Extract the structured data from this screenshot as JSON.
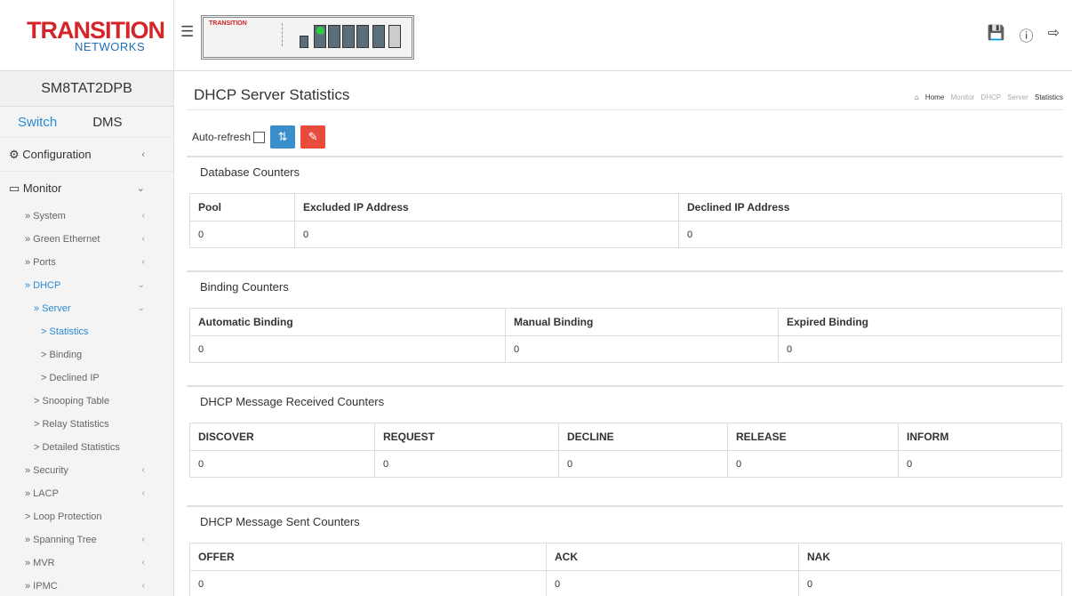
{
  "brand": {
    "logo_main": "TRANSITION",
    "logo_sub": "NETWORKS",
    "device_brand": "TRANSITION"
  },
  "header": {
    "menu_icon": "hamburger-icon",
    "icons": [
      "save-icon",
      "help-icon",
      "logout-icon"
    ]
  },
  "sidebar": {
    "device_name": "SM8TAT2DPB",
    "tabs": [
      "Switch",
      "DMS"
    ],
    "configuration": "Configuration",
    "monitor": "Monitor",
    "items": [
      {
        "label": "» System"
      },
      {
        "label": "» Green Ethernet"
      },
      {
        "label": "» Ports"
      },
      {
        "label": "» DHCP"
      },
      {
        "label": "» Server"
      },
      {
        "label": "> Statistics"
      },
      {
        "label": "> Binding"
      },
      {
        "label": "> Declined IP"
      },
      {
        "label": "> Snooping Table"
      },
      {
        "label": "> Relay Statistics"
      },
      {
        "label": "> Detailed Statistics"
      },
      {
        "label": "» Security"
      },
      {
        "label": "» LACP"
      },
      {
        "label": "> Loop Protection"
      },
      {
        "label": "» Spanning Tree"
      },
      {
        "label": "» MVR"
      },
      {
        "label": "» IPMC"
      }
    ]
  },
  "page": {
    "title": "DHCP Server Statistics",
    "breadcrumb": [
      "Home",
      "Monitor",
      "DHCP",
      "Server",
      "Statistics"
    ],
    "auto_refresh_label": "Auto-refresh",
    "auto_refresh_checked": false
  },
  "sections": {
    "database": {
      "title": "Database Counters",
      "headers": [
        "Pool",
        "Excluded IP Address",
        "Declined IP Address"
      ],
      "values": [
        "0",
        "0",
        "0"
      ]
    },
    "binding": {
      "title": "Binding Counters",
      "headers": [
        "Automatic Binding",
        "Manual Binding",
        "Expired Binding"
      ],
      "values": [
        "0",
        "0",
        "0"
      ]
    },
    "received": {
      "title": "DHCP Message Received Counters",
      "headers": [
        "DISCOVER",
        "REQUEST",
        "DECLINE",
        "RELEASE",
        "INFORM"
      ],
      "values": [
        "0",
        "0",
        "0",
        "0",
        "0"
      ]
    },
    "sent": {
      "title": "DHCP Message Sent Counters",
      "headers": [
        "OFFER",
        "ACK",
        "NAK"
      ],
      "values": [
        "0",
        "0",
        "0"
      ]
    }
  },
  "colors": {
    "accent": "#2a8ad3",
    "brand_red": "#d4252a",
    "refresh_btn": "#3a8ec9",
    "clear_btn": "#e74c3c"
  }
}
